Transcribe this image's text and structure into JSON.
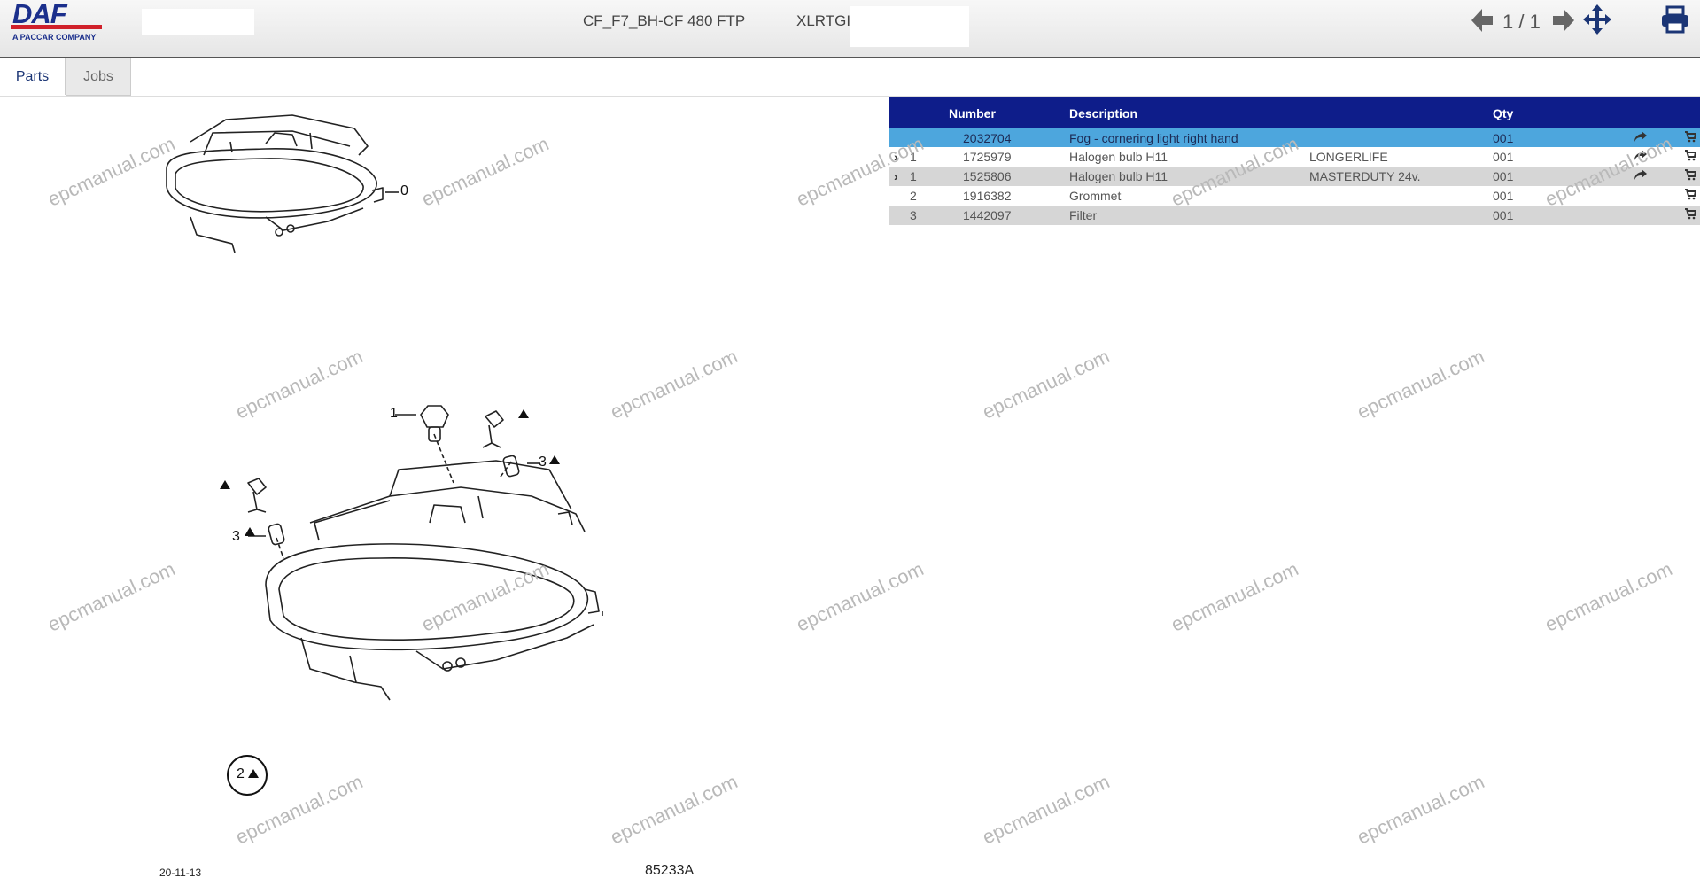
{
  "header": {
    "logo_text": "DAF",
    "logo_sub": "A PACCAR COMPANY",
    "model": "CF_F7_BH-CF 480 FTP",
    "vin": "XLRTGI",
    "page_indicator": "1 / 1",
    "icons": [
      "arrow-left-icon",
      "arrow-right-icon",
      "move-icon",
      "print-icon"
    ]
  },
  "tabs": [
    {
      "label": "Parts",
      "active": true
    },
    {
      "label": "Jobs",
      "active": false
    }
  ],
  "parts_table": {
    "columns": {
      "number": "Number",
      "description": "Description",
      "qty": "Qty"
    },
    "rows": [
      {
        "chevron": "",
        "pos": "",
        "number": "2032704",
        "description": "Fog - cornering light right hand",
        "remark": "",
        "qty": "001",
        "selected": true
      },
      {
        "chevron": "›",
        "pos": "1",
        "number": "1725979",
        "description": "Halogen bulb H11",
        "remark": "LONGERLIFE",
        "qty": "001"
      },
      {
        "chevron": "›",
        "pos": "1",
        "number": "1525806",
        "description": "Halogen bulb H11",
        "remark": "MASTERDUTY 24v.",
        "qty": "001"
      },
      {
        "chevron": "",
        "pos": "2",
        "number": "1916382",
        "description": "Grommet",
        "remark": "",
        "qty": "001"
      },
      {
        "chevron": "",
        "pos": "3",
        "number": "1442097",
        "description": "Filter",
        "remark": "",
        "qty": "001"
      }
    ]
  },
  "drawing": {
    "callouts": {
      "c0": "0",
      "c1": "1",
      "c2": "2",
      "c3a": "3",
      "c3b": "3"
    },
    "date": "20-11-13",
    "drawing_number": "85233A"
  },
  "watermark": "epcmanual.com",
  "colors": {
    "header_bar": "#0e1d8a",
    "selected_row": "#4da6dd",
    "alt_row": "#d6d6d6",
    "brand_blue": "#1b2f8c",
    "brand_red": "#d0202a"
  }
}
